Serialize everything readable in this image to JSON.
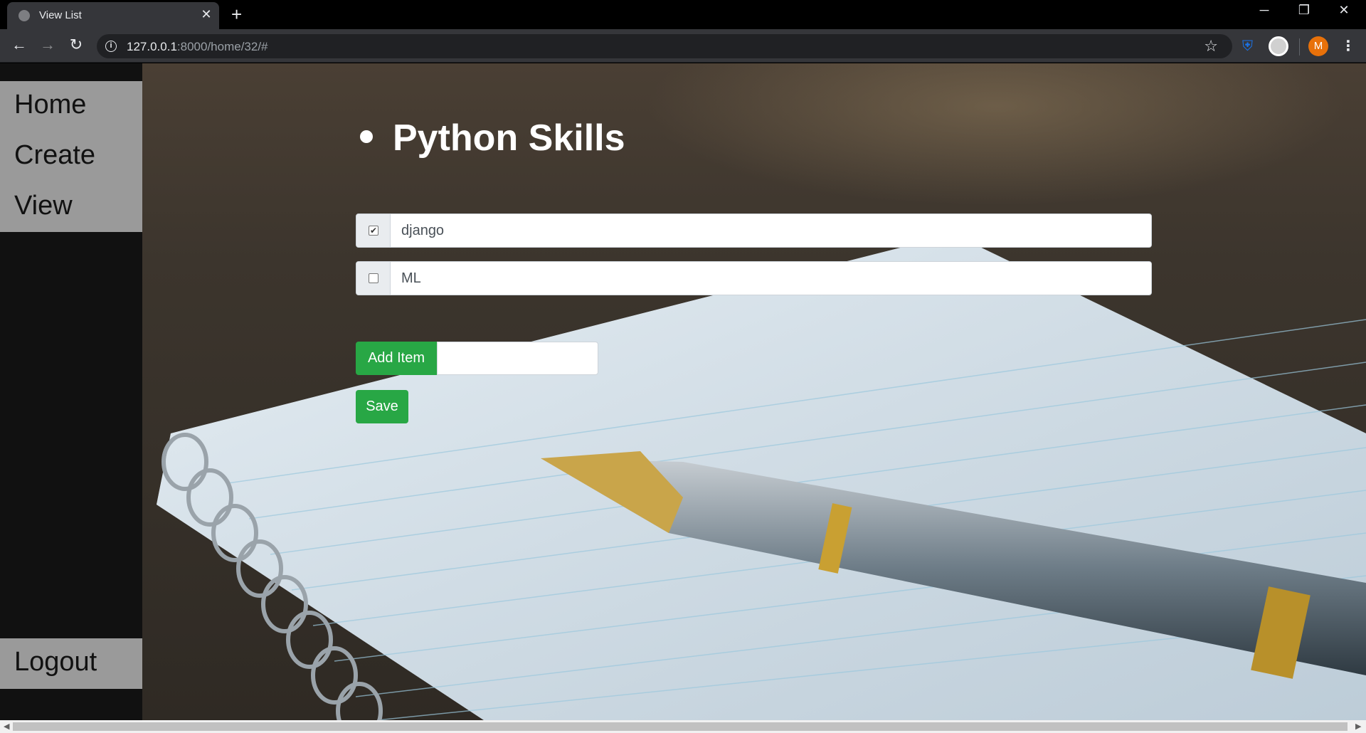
{
  "browser": {
    "tab_title": "View List",
    "url_host": "127.0.0.1",
    "url_rest": ":8000/home/32/#",
    "avatar_letter": "M"
  },
  "sidebar": {
    "items": [
      {
        "label": "Home"
      },
      {
        "label": "Create"
      },
      {
        "label": "View"
      }
    ],
    "logout_label": "Logout"
  },
  "list": {
    "title": "Python Skills",
    "items": [
      {
        "text": "django",
        "checked": true
      },
      {
        "text": "ML",
        "checked": false
      }
    ],
    "add_button_label": "Add Item",
    "add_input_value": "",
    "save_button_label": "Save"
  },
  "colors": {
    "button_green": "#28a745",
    "sidebar_dark": "#111111",
    "sidebar_block": "#9a9a9a"
  }
}
